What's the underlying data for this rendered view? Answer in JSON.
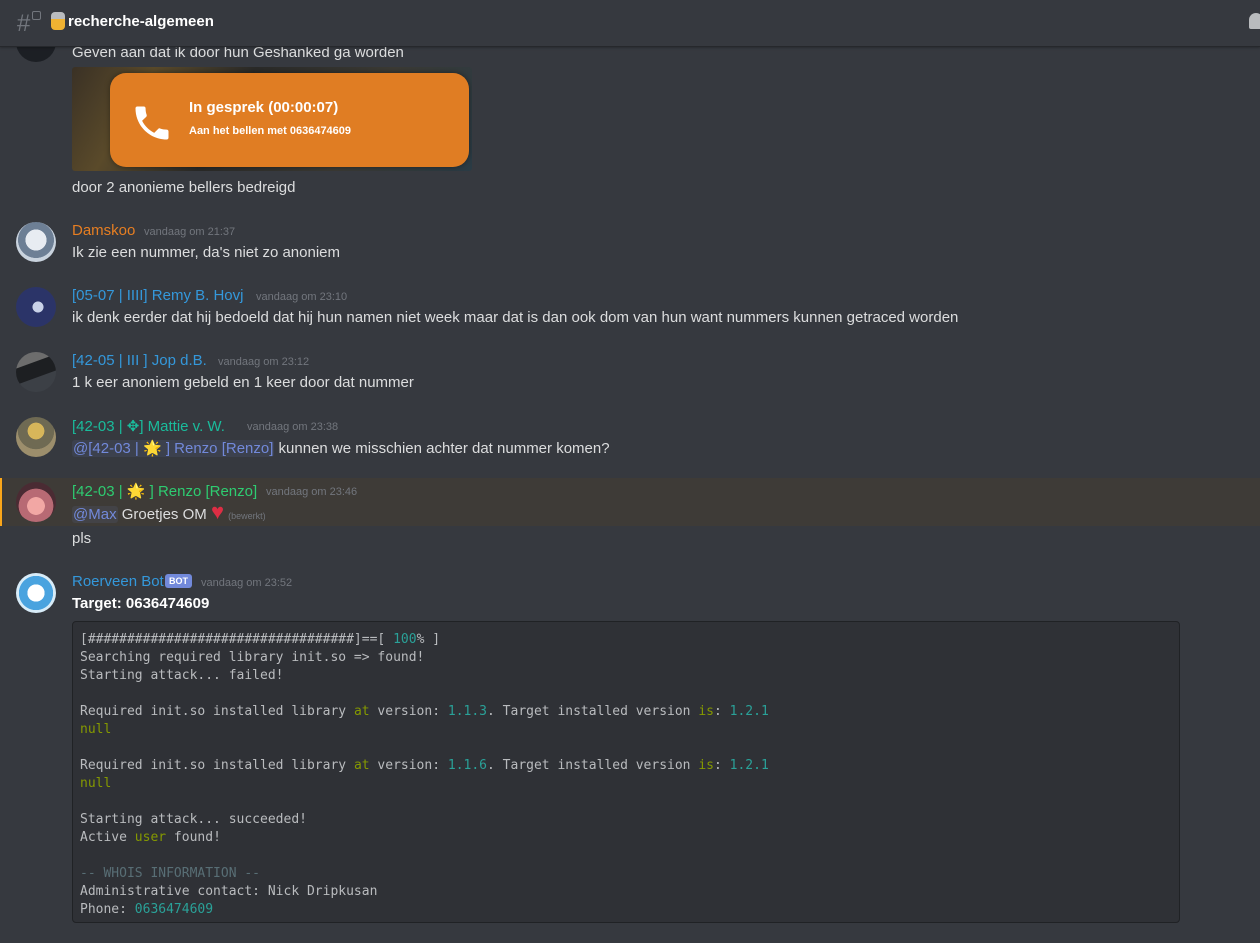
{
  "channel": {
    "name": "recherche-algemeen"
  },
  "messages": {
    "m1": {
      "line1": "Geven aan dat ik door hun Geshanked ga worden",
      "call_title": "In gesprek (00:00:07)",
      "call_sub": "Aan het bellen met 0636474609",
      "line2": "door 2 anonieme bellers bedreigd"
    },
    "m2": {
      "author": "Damskoo",
      "time": "vandaag om 21:37",
      "text": "Ik zie een nummer, da's niet zo anoniem",
      "color": "#e67e22"
    },
    "m3": {
      "author": "[05-07 | IIII] Remy B. Hovj",
      "time": "vandaag om 23:10",
      "text": "ik denk eerder dat hij bedoeld dat hij hun namen niet week maar dat is dan ook dom van hun want nummers kunnen getraced worden",
      "color": "#3498db"
    },
    "m4": {
      "author": "[42-05 | III ] Jop d.B.",
      "time": "vandaag om 23:12",
      "text": "1 k eer anoniem gebeld en 1 keer door dat nummer",
      "color": "#3498db"
    },
    "m5": {
      "author": "[42-03 | ✥] Mattie v. W.",
      "time": "vandaag om 23:38",
      "mention": "@[42-03 | 🌟 ] Renzo [Renzo]",
      "text": " kunnen we misschien achter dat nummer komen?",
      "color": "#1abc9c"
    },
    "m6": {
      "author": "[42-03 | 🌟 ] Renzo [Renzo]",
      "time": "vandaag om 23:46",
      "mention": "@Max",
      "text": " Groetjes OM ",
      "edited": "(bewerkt)",
      "line2": "pls",
      "color": "#2ecc71"
    },
    "m7": {
      "author": "Roerveen Bot",
      "bot_tag": "BOT",
      "time": "vandaag om 23:52",
      "title": "Target: 0636474609",
      "color": "#3498db"
    }
  },
  "code": {
    "l1a": "[##################################]==[ ",
    "l1b": "100",
    "l1c": "% ]",
    "l2": "Searching required library init.so => found!",
    "l3": "Starting attack... failed!",
    "l5a": "Required init.so installed library ",
    "at": "at",
    "l5b": " version: ",
    "v1": "1.1.3",
    "l5c": ". Target installed version ",
    "is": "is",
    "colon": ": ",
    "v2": "1.2.1",
    "null": "null",
    "v3": "1.1.6",
    "l11": "Starting attack... succeeded!",
    "l12a": "Active ",
    "user": "user",
    "l12b": " found!",
    "l14": "-- WHOIS INFORMATION --",
    "l15": "Administrative contact: Nick Dripkusan",
    "l16a": "Phone: ",
    "phone": "0636474609"
  }
}
